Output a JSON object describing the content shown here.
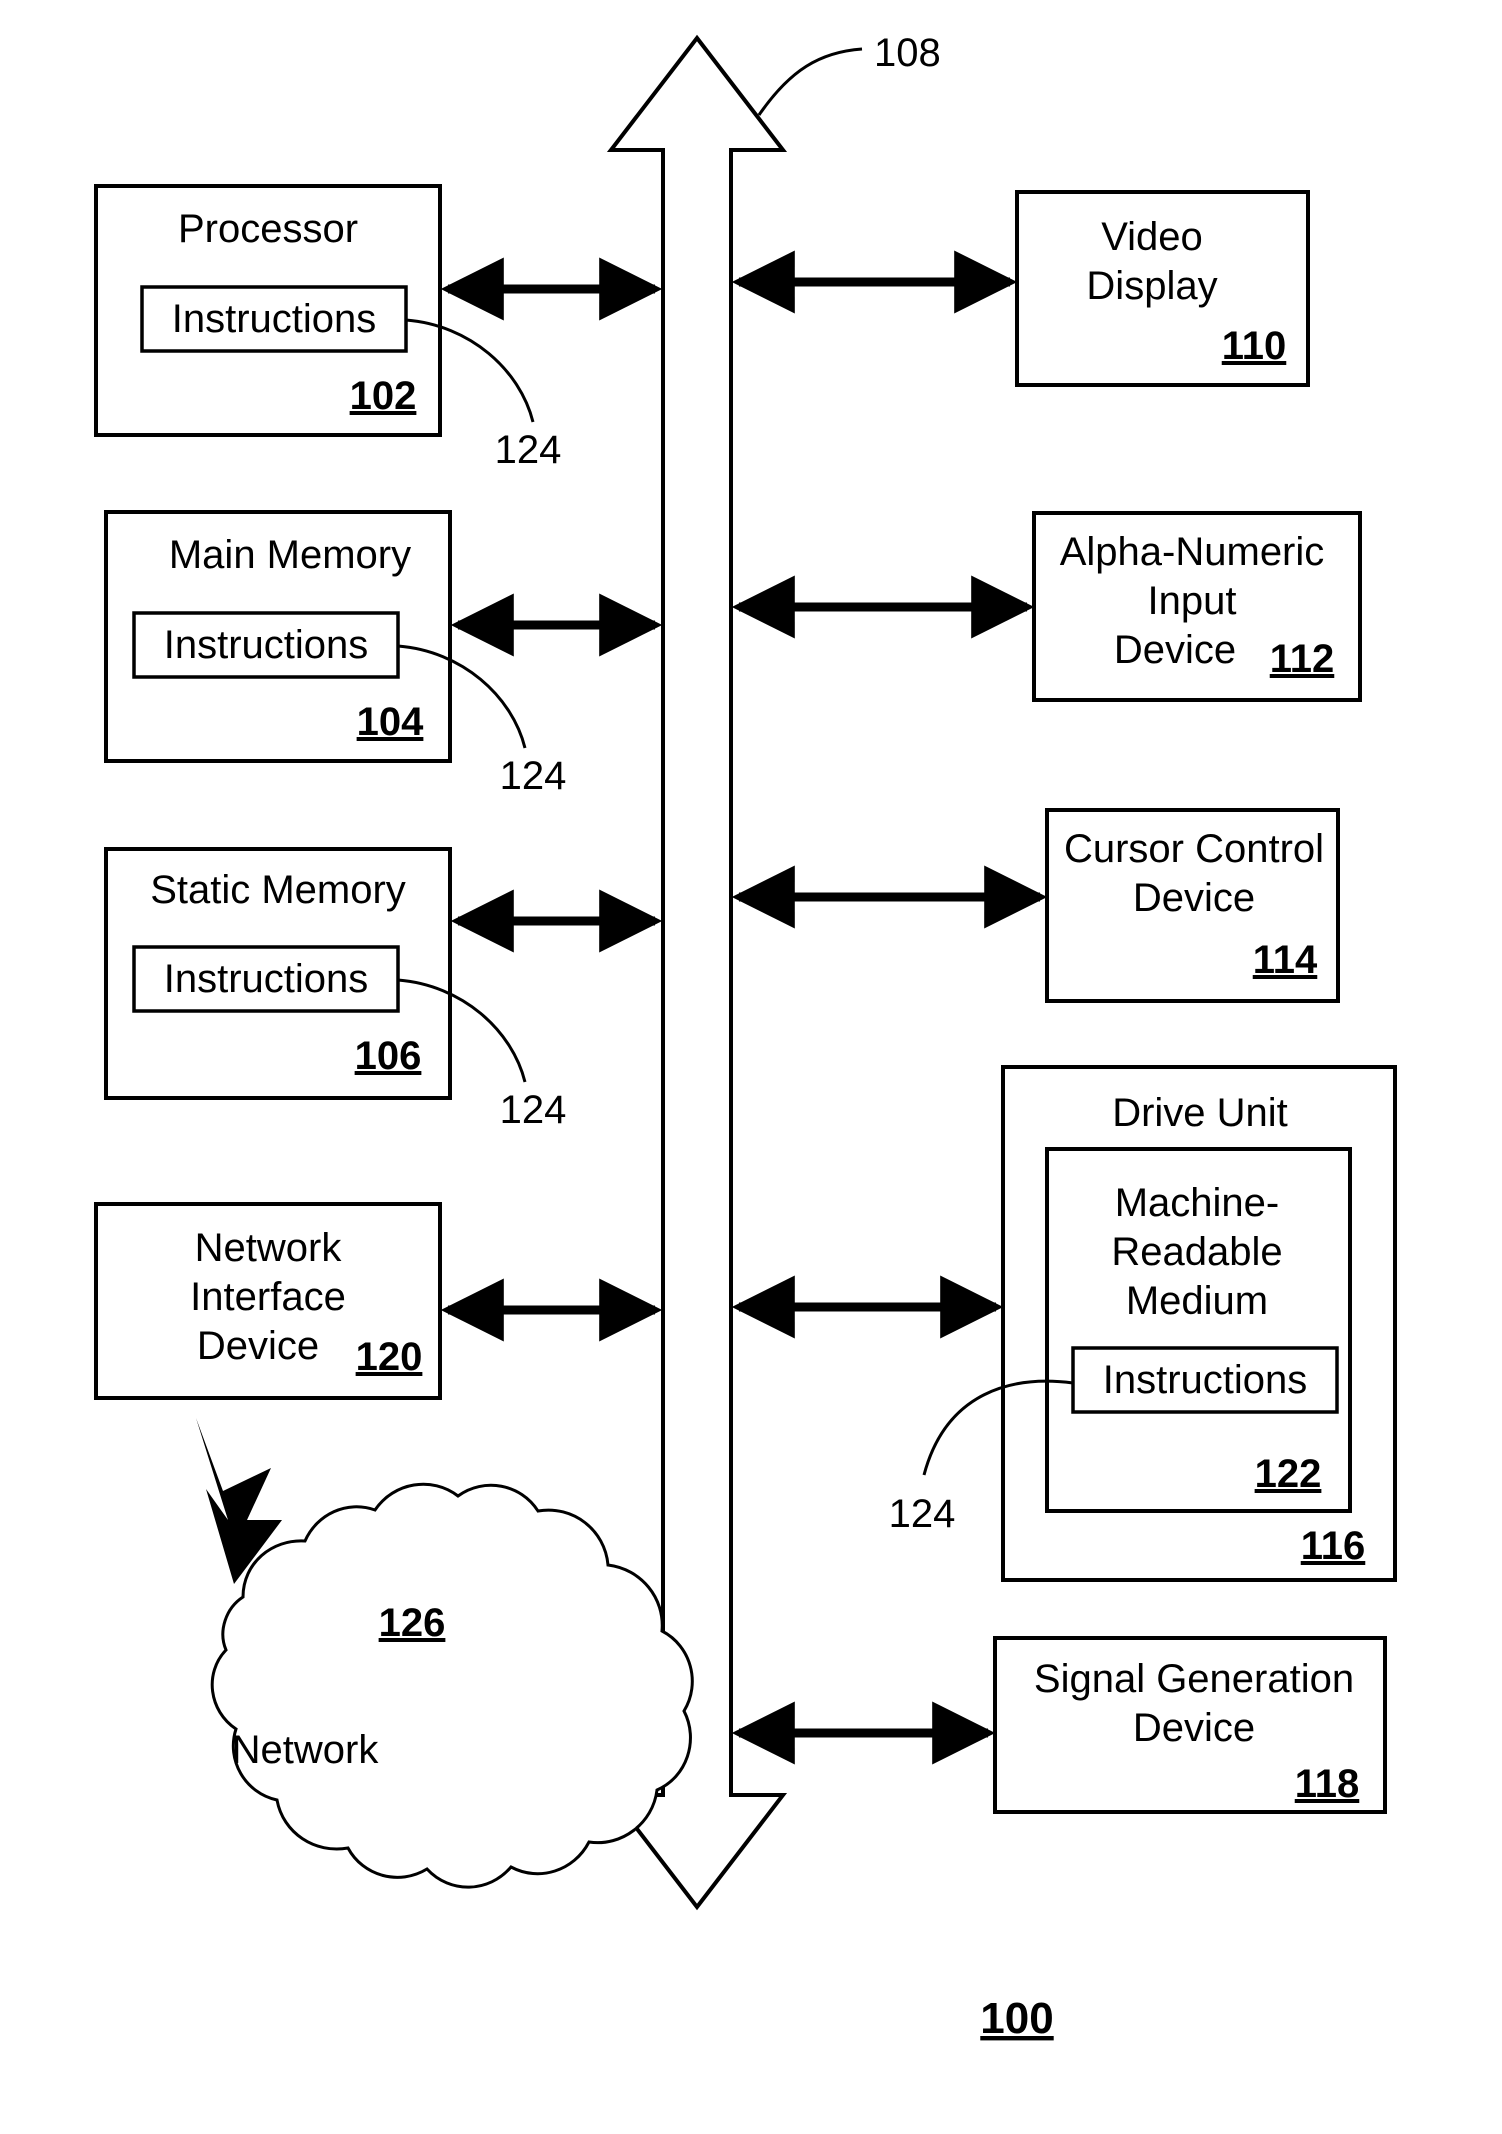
{
  "figure": {
    "number": "100",
    "bus": {
      "ref": "108"
    },
    "left_blocks": [
      {
        "id": "processor",
        "title": "Processor",
        "ref": "102",
        "inner_label": "Instructions",
        "inner_ref": "124"
      },
      {
        "id": "main-memory",
        "title": "Main Memory",
        "ref": "104",
        "inner_label": "Instructions",
        "inner_ref": "124"
      },
      {
        "id": "static-memory",
        "title": "Static Memory",
        "ref": "106",
        "inner_label": "Instructions",
        "inner_ref": "124"
      },
      {
        "id": "network-interface-device",
        "title_line1": "Network",
        "title_line2": "Interface",
        "title_line3": "Device",
        "ref": "120"
      }
    ],
    "network_cloud": {
      "label": "Network",
      "ref": "126"
    },
    "right_blocks": [
      {
        "id": "video-display",
        "title_line1": "Video",
        "title_line2": "Display",
        "ref": "110"
      },
      {
        "id": "alpha-numeric-input-device",
        "title_line1": "Alpha-Numeric",
        "title_line2": "Input",
        "title_line3": "Device",
        "ref": "112"
      },
      {
        "id": "cursor-control-device",
        "title_line1": "Cursor Control",
        "title_line2": "Device",
        "ref": "114"
      },
      {
        "id": "drive-unit",
        "title": "Drive Unit",
        "ref": "116",
        "medium": {
          "title_line1": "Machine-",
          "title_line2": "Readable",
          "title_line3": "Medium",
          "ref": "122",
          "inner_label": "Instructions",
          "inner_ref": "124"
        }
      },
      {
        "id": "signal-generation-device",
        "title_line1": "Signal Generation",
        "title_line2": "Device",
        "ref": "118"
      }
    ]
  },
  "colors": {
    "ink": "#000000",
    "paper": "#ffffff"
  }
}
